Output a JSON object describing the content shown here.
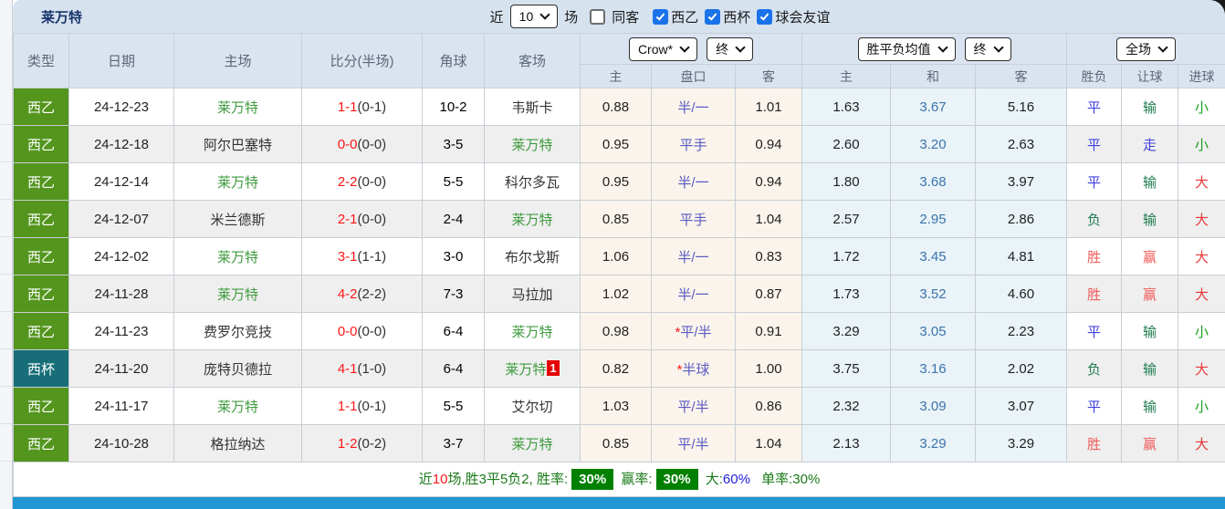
{
  "title": "莱万特",
  "filters": {
    "recent_label": "近",
    "recent_value": "10",
    "games_label": "场",
    "same_away": {
      "label": "同客",
      "checked": false
    },
    "leagues": [
      {
        "label": "西乙",
        "checked": true
      },
      {
        "label": "西杯",
        "checked": true
      },
      {
        "label": "球会友谊",
        "checked": true
      }
    ]
  },
  "header": {
    "type": "类型",
    "date": "日期",
    "home": "主场",
    "score": "比分(半场)",
    "corners": "角球",
    "away": "客场",
    "ah_company_select": "Crow*",
    "ah_time_select": "终",
    "ah_home": "主",
    "ah_line": "盘口",
    "ah_away": "客",
    "odds_type_select": "胜平负均值",
    "odds_time_select": "终",
    "odds_home": "主",
    "odds_draw": "和",
    "odds_away": "客",
    "period_select": "全场",
    "result_wdl": "胜负",
    "result_handicap": "让球",
    "result_goals": "进球"
  },
  "rows": [
    {
      "league": "西乙",
      "date": "24-12-23",
      "home": "莱万特",
      "score": "1-1",
      "half": "(0-1)",
      "corners": "10-2",
      "away": "韦斯卡",
      "ah_home": "0.88",
      "ah_line": "半/一",
      "ah_away": "1.01",
      "odds_home": "1.63",
      "odds_draw": "3.67",
      "odds_away": "5.16",
      "res_wdl": "平",
      "res_handicap": "输",
      "res_goals": "小"
    },
    {
      "league": "西乙",
      "date": "24-12-18",
      "home": "阿尔巴塞特",
      "score": "0-0",
      "half": "(0-0)",
      "corners": "3-5",
      "away": "莱万特",
      "ah_home": "0.95",
      "ah_line": "平手",
      "ah_away": "0.94",
      "odds_home": "2.60",
      "odds_draw": "3.20",
      "odds_away": "2.63",
      "res_wdl": "平",
      "res_handicap": "走",
      "res_goals": "小"
    },
    {
      "league": "西乙",
      "date": "24-12-14",
      "home": "莱万特",
      "score": "2-2",
      "half": "(0-0)",
      "corners": "5-5",
      "away": "科尔多瓦",
      "ah_home": "0.95",
      "ah_line": "半/一",
      "ah_away": "0.94",
      "odds_home": "1.80",
      "odds_draw": "3.68",
      "odds_away": "3.97",
      "res_wdl": "平",
      "res_handicap": "输",
      "res_goals": "大"
    },
    {
      "league": "西乙",
      "date": "24-12-07",
      "home": "米兰德斯",
      "score": "2-1",
      "half": "(0-0)",
      "corners": "2-4",
      "away": "莱万特",
      "ah_home": "0.85",
      "ah_line": "平手",
      "ah_away": "1.04",
      "odds_home": "2.57",
      "odds_draw": "2.95",
      "odds_away": "2.86",
      "res_wdl": "负",
      "res_handicap": "输",
      "res_goals": "大"
    },
    {
      "league": "西乙",
      "date": "24-12-02",
      "home": "莱万特",
      "score": "3-1",
      "half": "(1-1)",
      "corners": "3-0",
      "away": "布尔戈斯",
      "ah_home": "1.06",
      "ah_line": "半/一",
      "ah_away": "0.83",
      "odds_home": "1.72",
      "odds_draw": "3.45",
      "odds_away": "4.81",
      "res_wdl": "胜",
      "res_handicap": "赢",
      "res_goals": "大"
    },
    {
      "league": "西乙",
      "date": "24-11-28",
      "home": "莱万特",
      "score": "4-2",
      "half": "(2-2)",
      "corners": "7-3",
      "away": "马拉加",
      "ah_home": "1.02",
      "ah_line": "半/一",
      "ah_away": "0.87",
      "odds_home": "1.73",
      "odds_draw": "3.52",
      "odds_away": "4.60",
      "res_wdl": "胜",
      "res_handicap": "赢",
      "res_goals": "大"
    },
    {
      "league": "西乙",
      "date": "24-11-23",
      "home": "费罗尔竞技",
      "score": "0-0",
      "half": "(0-0)",
      "corners": "6-4",
      "away": "莱万特",
      "ah_home": "0.98",
      "ah_star": "*",
      "ah_line": "平/半",
      "ah_away": "0.91",
      "odds_home": "3.29",
      "odds_draw": "3.05",
      "odds_away": "2.23",
      "res_wdl": "平",
      "res_handicap": "输",
      "res_goals": "小"
    },
    {
      "league": "西杯",
      "date": "24-11-20",
      "home": "庞特贝德拉",
      "score": "4-1",
      "half": "(1-0)",
      "corners": "6-4",
      "away": "莱万特",
      "away_badge": "1",
      "ah_home": "0.82",
      "ah_star": "*",
      "ah_line": "半球",
      "ah_away": "1.00",
      "odds_home": "3.75",
      "odds_draw": "3.16",
      "odds_away": "2.02",
      "res_wdl": "负",
      "res_handicap": "输",
      "res_goals": "大"
    },
    {
      "league": "西乙",
      "date": "24-11-17",
      "home": "莱万特",
      "score": "1-1",
      "half": "(0-1)",
      "corners": "5-5",
      "away": "艾尔切",
      "ah_home": "1.03",
      "ah_line": "平/半",
      "ah_away": "0.86",
      "odds_home": "2.32",
      "odds_draw": "3.09",
      "odds_away": "3.07",
      "res_wdl": "平",
      "res_handicap": "输",
      "res_goals": "小"
    },
    {
      "league": "西乙",
      "date": "24-10-28",
      "home": "格拉纳达",
      "score": "1-2",
      "half": "(0-2)",
      "corners": "3-7",
      "away": "莱万特",
      "ah_home": "0.85",
      "ah_line": "平/半",
      "ah_away": "1.04",
      "odds_home": "2.13",
      "odds_draw": "3.29",
      "odds_away": "3.29",
      "res_wdl": "胜",
      "res_handicap": "赢",
      "res_goals": "大"
    }
  ],
  "summary": {
    "prefix": "近",
    "count": "10",
    "mid": "场,胜3平5负2, 胜率:",
    "win_rate": "30%",
    "label2": "赢率:",
    "win_rate2": "30%",
    "label3": "大:",
    "big_rate": "60%",
    "label4": "单率:",
    "single_rate": "30%"
  },
  "colors": {
    "league_badge_green": "#53951d",
    "cup_badge_teal": "#176e78",
    "score_red": "#ff1616",
    "self_team_green": "#3f9b3f",
    "handicap_blue": "#5a5ac2",
    "draw_odds_blue": "#3a74ad",
    "win_red": "#f15b5b",
    "draw_blue": "#4040e0",
    "lose_green": "#1e7b50",
    "big_red": "#e93a3a",
    "small_green": "#1a9e1a",
    "rate_badge_green": "#008000",
    "bottom_bar_blue": "#2196d3",
    "topbar_blue": "#d7e2ef"
  }
}
